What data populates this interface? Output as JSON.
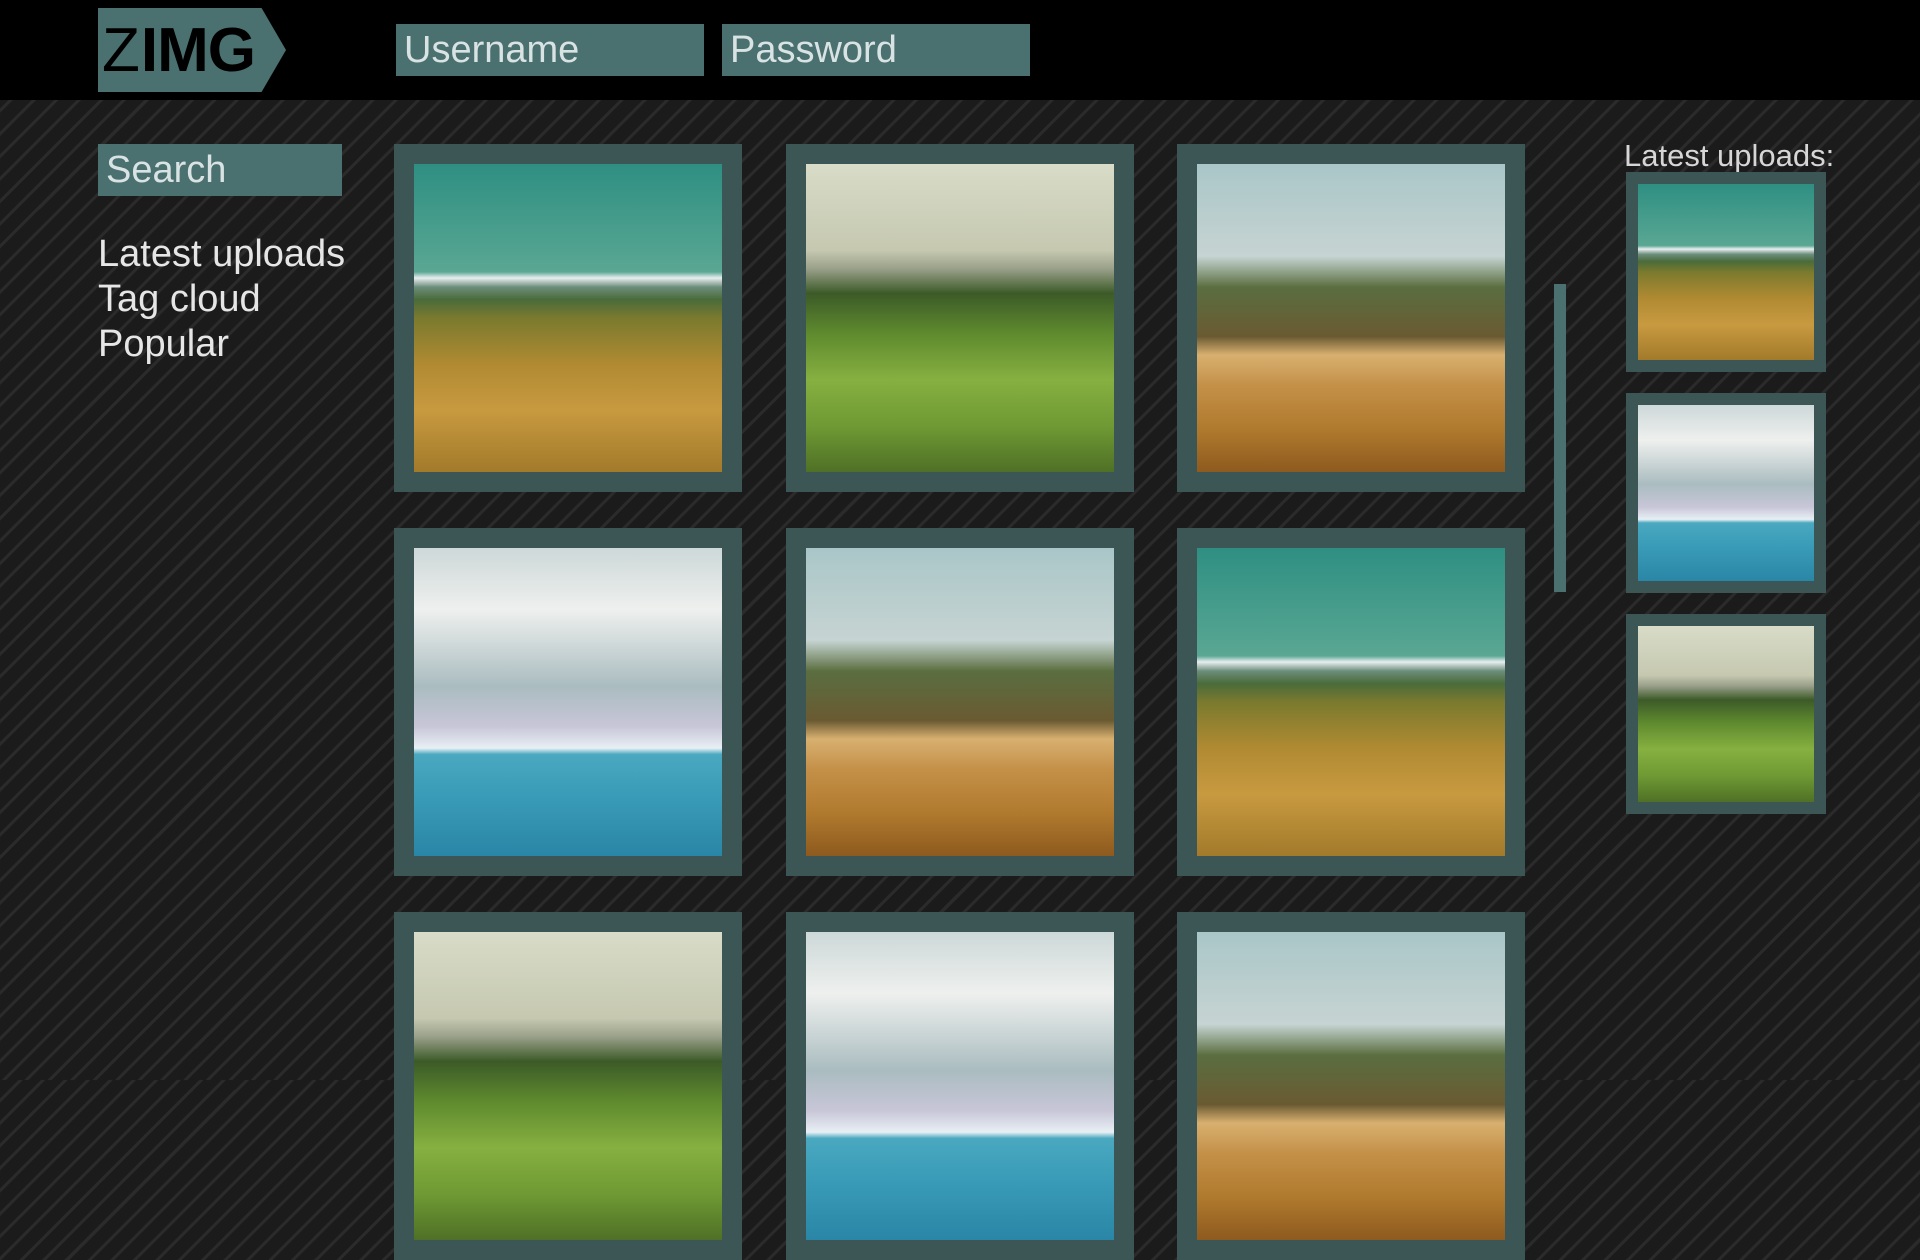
{
  "header": {
    "logo": {
      "light": "Z",
      "bold": "IMG"
    },
    "username_placeholder": "Username",
    "password_placeholder": "Password"
  },
  "sidebar": {
    "search_placeholder": "Search",
    "nav": [
      {
        "label": "Latest uploads"
      },
      {
        "label": "Tag cloud"
      },
      {
        "label": "Popular"
      }
    ]
  },
  "gallery": {
    "tiles": [
      {
        "photo": "meadow-mountains"
      },
      {
        "photo": "green-hills"
      },
      {
        "photo": "marsh-grass"
      },
      {
        "photo": "ocean-rainbow"
      },
      {
        "photo": "marsh-grass"
      },
      {
        "photo": "meadow-mountains"
      },
      {
        "photo": "green-hills"
      },
      {
        "photo": "ocean-rainbow"
      },
      {
        "photo": "marsh-grass"
      }
    ]
  },
  "latest": {
    "title": "Latest uploads:",
    "thumbs": [
      {
        "photo": "meadow-mountains"
      },
      {
        "photo": "ocean-rainbow"
      },
      {
        "photo": "green-hills"
      }
    ]
  },
  "colors": {
    "accent": "#4a7070",
    "frame": "#3c5656",
    "topbar": "#000000",
    "background": "#1b1b1b"
  }
}
